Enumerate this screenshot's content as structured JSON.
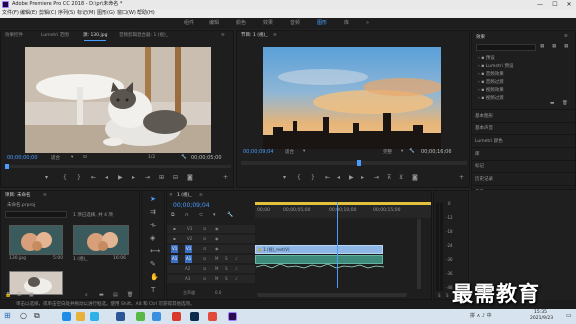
{
  "titlebar": {
    "title": "Adobe Premiere Pro CC 2018 - D:\\pr\\未命名 *",
    "minimize": "—",
    "maximize": "☐",
    "close": "✕"
  },
  "menu": [
    "文件(F)",
    "编辑(E)",
    "剪辑(C)",
    "序列(S)",
    "标记(M)",
    "图形(G)",
    "窗口(W)",
    "帮助(H)"
  ],
  "workspaces": {
    "items": [
      "组件",
      "编辑",
      "颜色",
      "效果",
      "音频",
      "图形",
      "库"
    ],
    "active_index": 5,
    "more": "»"
  },
  "source_panel": {
    "tabs": [
      "效果控件",
      "Lumetri 范围",
      "源: 130.jpg",
      "音频剪辑混合器: 1 (视)_",
      "≡"
    ],
    "active_tab_index": 2,
    "timecode_left": "00;00;00;00",
    "fit": "适合",
    "resolution": "1/2",
    "timecode_right": "00;00;05;00"
  },
  "program_panel": {
    "tabs": [
      "节目: 1 (视)_",
      "≡"
    ],
    "timecode_left": "00;00;09;04",
    "fit": "适合",
    "resolution": "完整",
    "timecode_right": "00;00;16;06"
  },
  "effects_panel": {
    "title": "效果",
    "search_placeholder": "",
    "tree": [
      "预设",
      "Lumetri 预设",
      "音频效果",
      "音频过渡",
      "视频效果",
      "视频过渡"
    ],
    "sections": [
      "基本图形",
      "基本声音",
      "Lumetri 颜色",
      "库",
      "标记",
      "历史记录",
      "信息"
    ]
  },
  "project_panel": {
    "tabs": [
      "项目: 未命名",
      "≡"
    ],
    "file": "未命名.prproj",
    "selection": "1 项已选择, 共 4 项",
    "items": [
      {
        "name": "130.jpg",
        "duration": "5:00"
      },
      {
        "name": "1 (视)_",
        "duration": "16:06"
      },
      {
        "name": "1 (视)_",
        "duration": ""
      }
    ]
  },
  "timeline": {
    "tab": "1 (视)_",
    "timecode": "00;00;09;04",
    "ruler": [
      "00;00",
      "00;00;05;00",
      "00;00;10;00",
      "00;00;15;00"
    ],
    "video_tracks": [
      "V3",
      "V2",
      "V1"
    ],
    "audio_tracks": [
      "A1",
      "A2",
      "A3"
    ],
    "master": "主声道",
    "master_value": "0.0",
    "clip_label": "1 (视)_rest(V)",
    "playhead_fraction": 0.467
  },
  "status": "单击以选择，或单击空白处并拖动以进行框选。使用 Shift、Alt 和 Ctrl 可获得其他选项。",
  "watermark": "最需教育",
  "clock": {
    "time": "15:35",
    "date": "2021/9/23"
  },
  "tray": "拼 ∧ ♪ 中"
}
